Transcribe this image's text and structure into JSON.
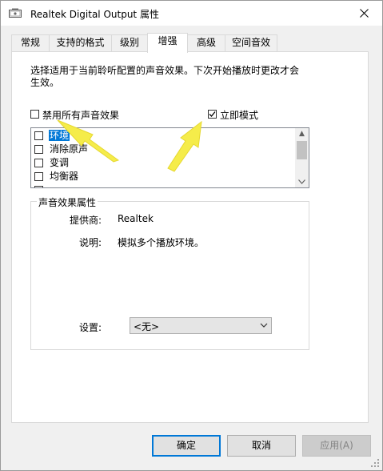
{
  "window": {
    "title": "Realtek Digital Output 属性"
  },
  "tabs": [
    {
      "label": "常规"
    },
    {
      "label": "支持的格式"
    },
    {
      "label": "级别"
    },
    {
      "label": "增强"
    },
    {
      "label": "高级"
    },
    {
      "label": "空间音效"
    }
  ],
  "active_tab": "增强",
  "enhancements": {
    "description": "选择适用于当前聆听配置的声音效果。下次开始播放时更改才会生效。",
    "disable_all": {
      "label": "禁用所有声音效果",
      "checked": false
    },
    "immediate_mode": {
      "label": "立即模式",
      "checked": true
    },
    "effects_list": [
      {
        "label": "环境",
        "checked": false,
        "selected": true
      },
      {
        "label": "消除原声",
        "checked": false,
        "selected": false
      },
      {
        "label": "变调",
        "checked": false,
        "selected": false
      },
      {
        "label": "均衡器",
        "checked": false,
        "selected": false
      }
    ],
    "properties": {
      "legend": "声音效果属性",
      "provider_label": "提供商:",
      "provider_value": "Realtek",
      "description_label": "说明:",
      "description_value": "模拟多个播放环境。",
      "setting_label": "设置:",
      "setting_value": "<无>"
    }
  },
  "buttons": {
    "ok": "确定",
    "cancel": "取消",
    "apply": "应用(A)"
  },
  "annotation_color": "#f5ec4a",
  "accent_color": "#0078d7",
  "icons": {
    "app": "speaker-icon",
    "close": "close-icon",
    "check": "check-icon",
    "dropdown": "chevron-down-icon"
  }
}
